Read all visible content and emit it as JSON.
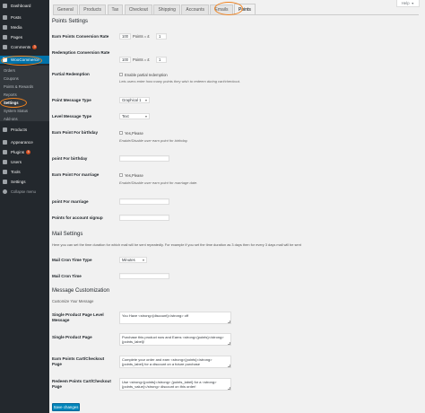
{
  "sidebar": {
    "items": [
      {
        "label": "Dashboard",
        "icon": "dashboard-icon"
      },
      {
        "label": "Posts",
        "icon": "pin-icon"
      },
      {
        "label": "Media",
        "icon": "media-icon"
      },
      {
        "label": "Pages",
        "icon": "page-icon"
      },
      {
        "label": "Comments",
        "icon": "comment-icon",
        "badge": "3"
      },
      {
        "label": "WooCommerce",
        "icon": "woocommerce-icon"
      },
      {
        "label": "Products",
        "icon": "products-icon"
      },
      {
        "label": "Appearance",
        "icon": "appearance-icon"
      },
      {
        "label": "Plugins",
        "icon": "plugins-icon",
        "badge": "4"
      },
      {
        "label": "Users",
        "icon": "users-icon"
      },
      {
        "label": "Tools",
        "icon": "tools-icon"
      },
      {
        "label": "Settings",
        "icon": "settings-icon"
      },
      {
        "label": "Collapse menu",
        "icon": "collapse-icon"
      }
    ],
    "woo_submenu": [
      "Orders",
      "Coupons",
      "Points & Rewards",
      "Reports",
      "Settings",
      "System Status",
      "Add-ons"
    ]
  },
  "help": {
    "label": "Help"
  },
  "tabs": [
    "General",
    "Products",
    "Tax",
    "Checkout",
    "Shipping",
    "Accounts",
    "Emails",
    "Points"
  ],
  "active_tab": "Points",
  "points_settings": {
    "title": "Points Settings",
    "earn_rate": {
      "label": "Earn Points Conversion Rate",
      "points_value": "100",
      "middle_text": "Points = £",
      "currency_value": "1"
    },
    "redeem_rate": {
      "label": "Redemption Conversion Rate",
      "points_value": "100",
      "middle_text": "Points = £",
      "currency_value": "1"
    },
    "partial_redemption": {
      "label": "Partial Redemption",
      "checkbox_label": "Enable partial redemption",
      "hint": "Lets users enter how many points they wish to redeem during cart/checkout."
    },
    "point_message_type": {
      "label": "Point Message Type",
      "value": "Graphical 1"
    },
    "level_message_type": {
      "label": "Level Message Type",
      "value": "Text"
    },
    "earn_birthday": {
      "label": "Earn Point For birthday",
      "checkbox_label": "Yes,Please",
      "hint": "Enable/Disable user earn point for birthday."
    },
    "point_birthday": {
      "label": "point For birthday",
      "value": ""
    },
    "earn_marriage": {
      "label": "Earn Point For marriage",
      "checkbox_label": "Yes,Please",
      "hint": "Enable/Disable user earn point for marriage date."
    },
    "point_marriage": {
      "label": "point For marriage",
      "value": ""
    },
    "points_signup": {
      "label": "Points for account signup",
      "value": ""
    }
  },
  "mail_settings": {
    "title": "Mail Settings",
    "description": "Here you can set the time duration for which mail will be sent repeatedly. For example if you set the time duration as 3 days then for every 3 days mail will be sent",
    "cron_type": {
      "label": "Mail Cron Time Type",
      "value": "Minutes"
    },
    "cron_time": {
      "label": "Mail Cron Time",
      "value": ""
    }
  },
  "message_customization": {
    "title": "Message Customization",
    "subtitle": "Customize Your Message",
    "single_level": {
      "label": "Single Product Page Level Message",
      "value": "You Have <strong>{discount}</strong> off"
    },
    "single_page": {
      "label": "Single Product Page",
      "value": "Purchase this product now and Earns <strong>{points}</strong> {points_label}!"
    },
    "earn_cart": {
      "label": "Earn Points Cart/Checkout Page",
      "value": "Complete your order and earn <strong>{points}</strong> {points_label} for a discount on a future purchase"
    },
    "redeem_cart": {
      "label": "Redeem Points Cart/Checkout Page",
      "value": "Use <strong>{points}</strong> {points_label} for a <strong>{points_value}</strong> discount on this order!"
    }
  },
  "save_button": {
    "label": "Save changes"
  },
  "colors": {
    "sidebar": "#23282d",
    "active_menu": "#0073aa",
    "primary_button": "#0085ba",
    "highlight_circle": "#f0821e"
  }
}
